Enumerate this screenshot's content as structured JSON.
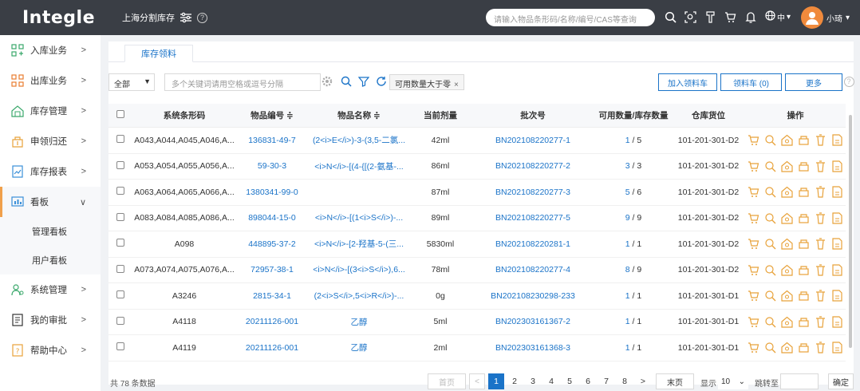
{
  "app": {
    "logo": "Integle",
    "org_name": "上海分割库存",
    "search_placeholder": "请输入物品条形码/名称/编号/CAS等查询",
    "lang": "中",
    "user_name": "小琦",
    "accent": "#1a73c8",
    "topbar_bg": "#3a3e45"
  },
  "sidebar": {
    "items": [
      {
        "label": "入库业务",
        "icon": "inbound-icon"
      },
      {
        "label": "出库业务",
        "icon": "outbound-icon"
      },
      {
        "label": "库存管理",
        "icon": "stock-icon"
      },
      {
        "label": "申领归还",
        "icon": "claim-icon"
      },
      {
        "label": "库存报表",
        "icon": "report-icon"
      },
      {
        "label": "看板",
        "icon": "dashboard-icon",
        "expanded": true
      },
      {
        "label": "系统管理",
        "icon": "system-icon"
      },
      {
        "label": "我的审批",
        "icon": "approval-icon"
      },
      {
        "label": "帮助中心",
        "icon": "help-icon"
      }
    ],
    "sub_items": [
      {
        "label": "管理看板"
      },
      {
        "label": "用户看板"
      }
    ]
  },
  "tab": {
    "label": "库存领料"
  },
  "filters": {
    "select_value": "全部",
    "input_placeholder": "多个关键词请用空格或逗号分隔",
    "chip_label": "可用数量大于零",
    "chip_close": "×",
    "btn_add_cart": "加入领料车",
    "btn_cart": "领料车 (0)",
    "btn_more": "更多"
  },
  "table": {
    "headers": [
      "系统条形码",
      "物品编号 ≑",
      "物品名称 ≑",
      "当前剂量",
      "批次号",
      "可用数量/库存数量",
      "仓库货位",
      "操作"
    ],
    "rows": [
      {
        "barcode": "A043,A044,A045,A046,A...",
        "code": "136831-49-7",
        "name": "(2<i>E</i>)-3-(3,5-二氯...",
        "dose": "42ml",
        "batch": "BN202108220277-1",
        "avail": "1",
        "stock": "5",
        "location": "101-201-301-D2"
      },
      {
        "barcode": "A053,A054,A055,A056,A...",
        "code": "59-30-3",
        "name": "<i>N</i>-[(4-{[(2-氨基-...",
        "dose": "86ml",
        "batch": "BN202108220277-2",
        "avail": "3",
        "stock": "3",
        "location": "101-201-301-D2"
      },
      {
        "barcode": "A063,A064,A065,A066,A...",
        "code": "1380341-99-0",
        "name": "",
        "dose": "87ml",
        "batch": "BN202108220277-3",
        "avail": "5",
        "stock": "6",
        "location": "101-201-301-D2"
      },
      {
        "barcode": "A083,A084,A085,A086,A...",
        "code": "898044-15-0",
        "name": "<i>N</i>-[(1<i>S</i>)-...",
        "dose": "89ml",
        "batch": "BN202108220277-5",
        "avail": "9",
        "stock": "9",
        "location": "101-201-301-D2"
      },
      {
        "barcode": "A098",
        "code": "448895-37-2",
        "name": "<i>N</i>-[2-羟基-5-(三...",
        "dose": "5830ml",
        "batch": "BN202108220281-1",
        "avail": "1",
        "stock": "1",
        "location": "101-201-301-D2"
      },
      {
        "barcode": "A073,A074,A075,A076,A...",
        "code": "72957-38-1",
        "name": "<i>N</i>-[(3<i>S</i>),6...",
        "dose": "78ml",
        "batch": "BN202108220277-4",
        "avail": "8",
        "stock": "9",
        "location": "101-201-301-D2"
      },
      {
        "barcode": "A3246",
        "code": "2815-34-1",
        "name": "(2<i>S</i>,5<i>R</i>)-...",
        "dose": "0g",
        "batch": "BN202108230298-233",
        "avail": "1",
        "stock": "1",
        "location": "101-201-301-D1"
      },
      {
        "barcode": "A4118",
        "code": "20211126-001",
        "name": "乙醇",
        "dose": "5ml",
        "batch": "BN202303161367-2",
        "avail": "1",
        "stock": "1",
        "location": "101-201-301-D1"
      },
      {
        "barcode": "A4119",
        "code": "20211126-001",
        "name": "乙醇",
        "dose": "2ml",
        "batch": "BN202303161368-3",
        "avail": "1",
        "stock": "1",
        "location": "101-201-301-D1"
      }
    ],
    "op_icons": [
      "cart-icon",
      "search-detail-icon",
      "location-icon",
      "transfer-icon",
      "delete-icon",
      "document-icon"
    ]
  },
  "footer": {
    "total": "共 78 条数据",
    "first": "首页",
    "prev": "<",
    "pages": [
      "1",
      "2",
      "3",
      "4",
      "5",
      "6",
      "7",
      "8"
    ],
    "next": ">",
    "last": "末页",
    "show_label": "显示",
    "page_size": "10",
    "jump_label": "跳转至",
    "confirm": "确定"
  }
}
